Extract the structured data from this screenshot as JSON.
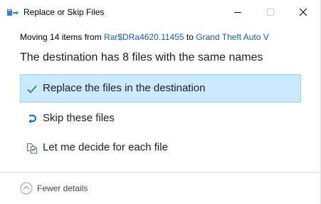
{
  "window": {
    "title": "Replace or Skip Files",
    "icon": "file-move-icon"
  },
  "controls": {
    "minimize_icon": "minimize-icon",
    "maximize_icon": "maximize-icon",
    "close_icon": "close-icon"
  },
  "status": {
    "prefix": "Moving 14 items from ",
    "source": "Rar$DRa4620.11455",
    "middle": " to ",
    "destination": "Grand Theft Auto V"
  },
  "headline": "The destination has 8 files with the same names",
  "options": [
    {
      "label": "Replace the files in the destination",
      "icon": "checkmark-icon",
      "selected": true
    },
    {
      "label": "Skip these files",
      "icon": "skip-arrow-icon",
      "selected": false
    },
    {
      "label": "Let me decide for each file",
      "icon": "compare-files-icon",
      "selected": false
    }
  ],
  "footer": {
    "details_label": "Fewer details",
    "details_icon": "chevron-up-icon"
  },
  "colors": {
    "link": "#1a5ea8",
    "selected_bg": "#cce8ff",
    "selected_border": "#99d1ff",
    "check_green": "#2f9e44",
    "skip_blue": "#1a73c8"
  }
}
